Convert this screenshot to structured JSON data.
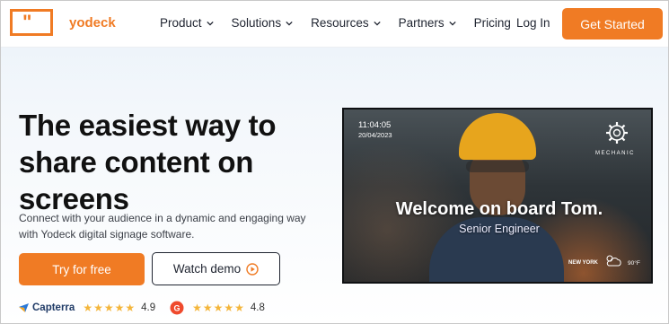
{
  "brand": {
    "logo_mark": "\"",
    "name": "yodeck",
    "color": "#f07b24"
  },
  "nav": {
    "items": [
      {
        "label": "Product",
        "has_dropdown": true
      },
      {
        "label": "Solutions",
        "has_dropdown": true
      },
      {
        "label": "Resources",
        "has_dropdown": true
      },
      {
        "label": "Partners",
        "has_dropdown": true
      },
      {
        "label": "Pricing",
        "has_dropdown": false
      }
    ],
    "login": "Log In",
    "cta": "Get Started"
  },
  "hero": {
    "title": "The easiest way to share content on screens",
    "subtitle": "Connect with your audience in a dynamic and engaging way with Yodeck digital signage software.",
    "primary_button": "Try for free",
    "secondary_button": "Watch demo",
    "secondary_icon": "play-circle-icon"
  },
  "ratings": [
    {
      "source": "Capterra",
      "stars": "★★★★★",
      "score": "4.9"
    },
    {
      "source": "G2",
      "stars": "★★★★★",
      "score": "4.8"
    }
  ],
  "screen": {
    "time": "11:04:05",
    "date": "20/04/2023",
    "badge_label": "MECHANIC",
    "badge_icon": "gear-icon",
    "welcome": "Welcome on board Tom.",
    "role": "Senior Engineer",
    "city": "NEW YORK",
    "weather_icon": "cloud-sun-icon",
    "temperature": "90°F"
  }
}
